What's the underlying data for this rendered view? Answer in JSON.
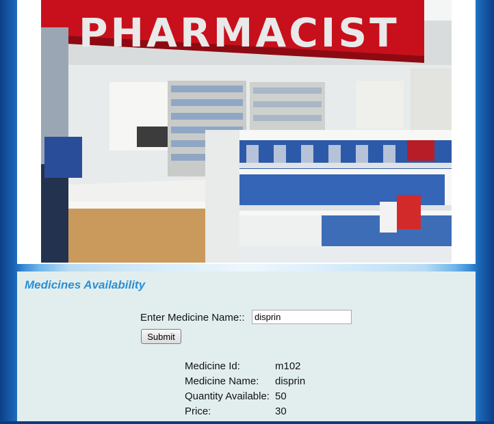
{
  "header": {
    "sign_text": "PHARMACIST"
  },
  "section": {
    "title": "Medicines Availability"
  },
  "form": {
    "label": "Enter Medicine Name::",
    "input_value": "disprin",
    "submit_label": "Submit"
  },
  "result": {
    "rows": [
      {
        "label": "Medicine Id:",
        "value": "m102"
      },
      {
        "label": "Medicine Name:",
        "value": "disprin"
      },
      {
        "label": "Quantity Available:",
        "value": "50"
      },
      {
        "label": "Price:",
        "value": "30"
      }
    ]
  },
  "colors": {
    "heading": "#2a8fd6",
    "panel_bg": "#e2eeee",
    "sign_red": "#c8101c"
  }
}
